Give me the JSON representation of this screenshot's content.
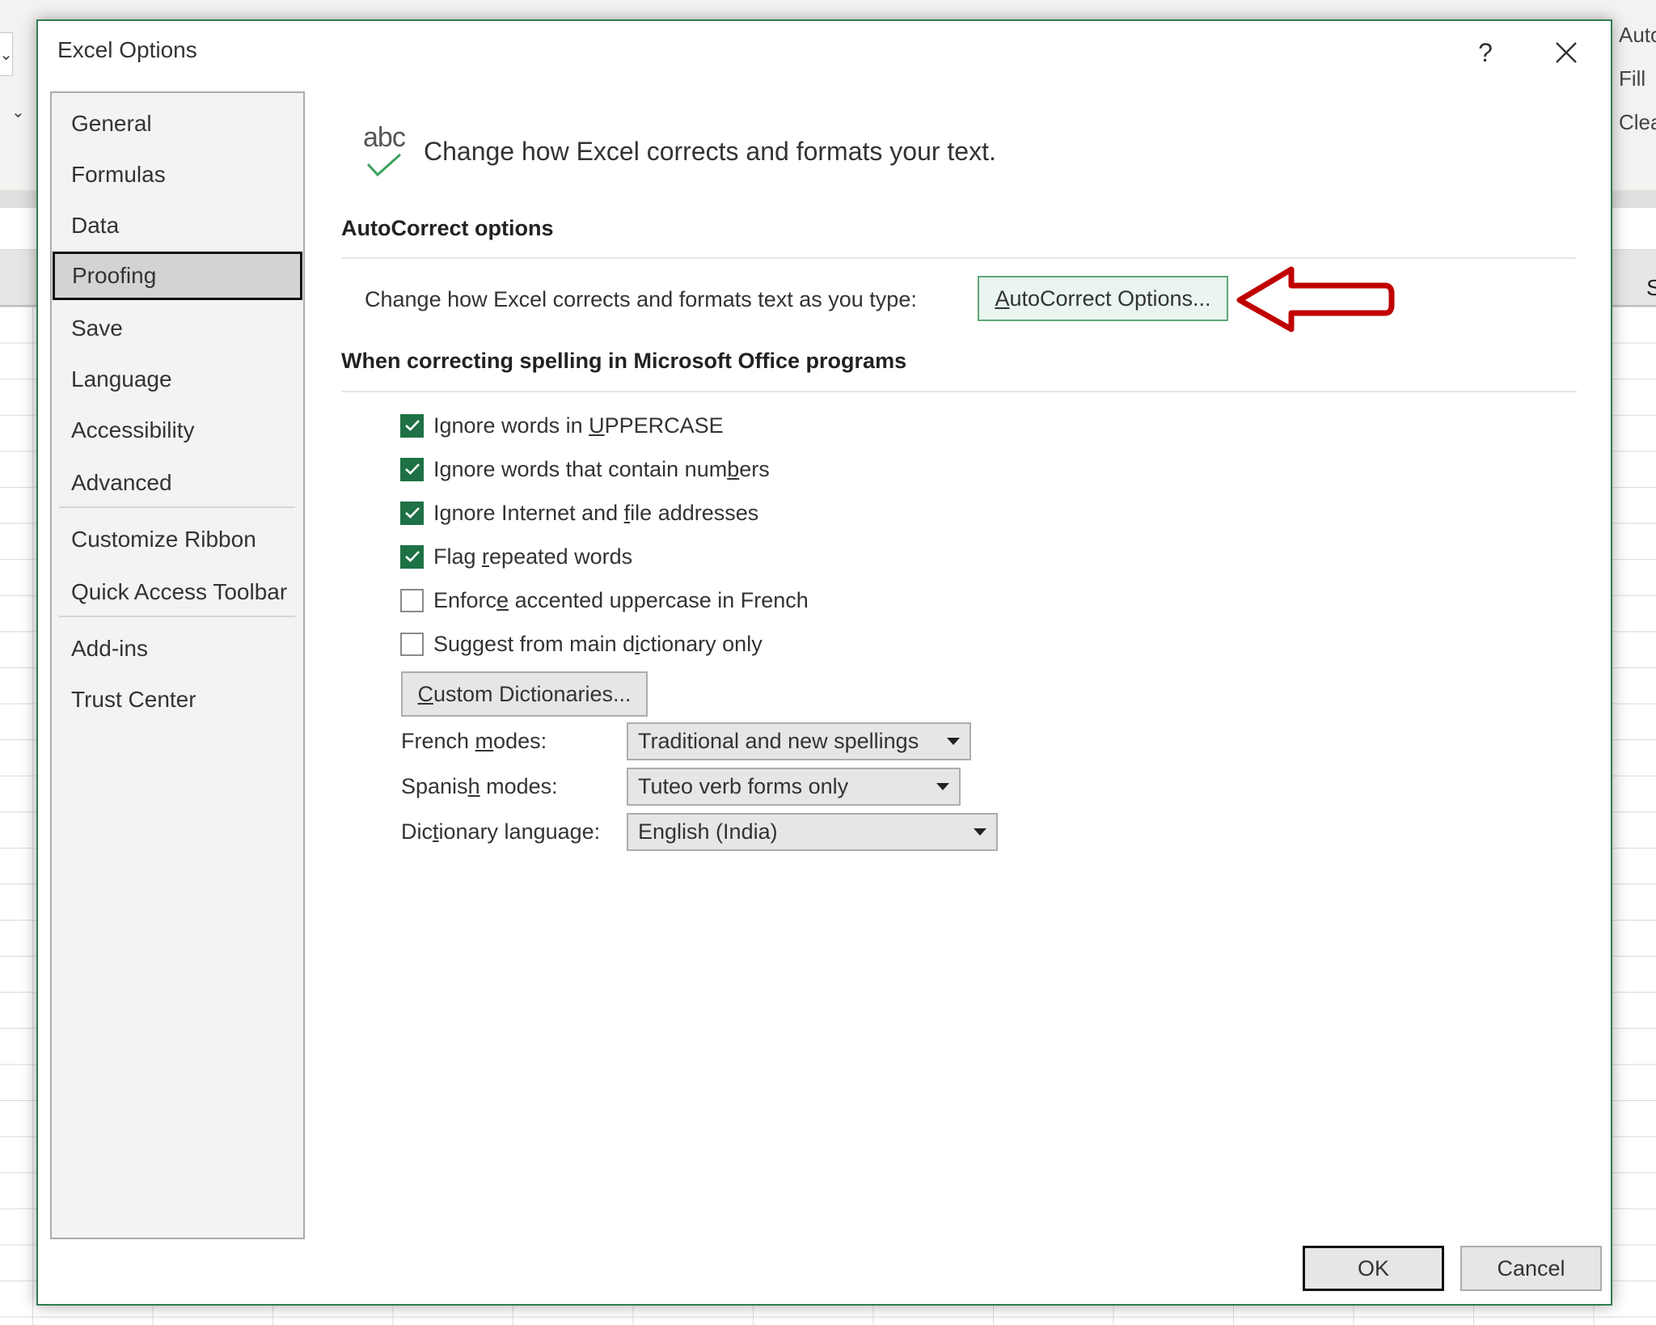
{
  "background": {
    "right_ribbon_items": [
      "Auto",
      "Fill",
      "Clea"
    ],
    "column_letter": "S"
  },
  "dialog": {
    "title": "Excel Options",
    "help_label": "?",
    "close_icon": "close-icon"
  },
  "sidebar": {
    "selected": "Proofing",
    "groups": [
      [
        "General",
        "Formulas",
        "Data",
        "Proofing",
        "Save",
        "Language",
        "Accessibility",
        "Advanced"
      ],
      [
        "Customize Ribbon",
        "Quick Access Toolbar"
      ],
      [
        "Add-ins",
        "Trust Center"
      ]
    ]
  },
  "header": {
    "icon": "abc-check-icon",
    "icon_text": "abc",
    "text": "Change how Excel corrects and formats your text."
  },
  "autocorrect": {
    "title": "AutoCorrect options",
    "description": "Change how Excel corrects and formats text as you type:",
    "button": {
      "accel": "A",
      "rest": "utoCorrect Options..."
    },
    "annotation": "red-arrow-pointing-left"
  },
  "spelling": {
    "title": "When correcting spelling in Microsoft Office programs",
    "options": [
      {
        "pre": "Ignore words in ",
        "accel": "U",
        "post": "PPERCASE",
        "checked": true
      },
      {
        "pre": "Ignore words that contain num",
        "accel": "b",
        "post": "ers",
        "checked": true
      },
      {
        "pre": "Ignore Internet and ",
        "accel": "f",
        "post": "ile addresses",
        "checked": true
      },
      {
        "pre": "Flag ",
        "accel": "r",
        "post": "epeated words",
        "checked": true
      },
      {
        "pre": "Enforc",
        "accel": "e",
        "post": " accented uppercase in French",
        "checked": false
      },
      {
        "pre": "Suggest from main d",
        "accel": "i",
        "post": "ctionary only",
        "checked": false
      }
    ],
    "custom_dictionaries": {
      "accel": "C",
      "rest": "ustom Dictionaries..."
    },
    "french_modes": {
      "pre": "French ",
      "accel": "m",
      "post": "odes:",
      "value": "Traditional and new spellings"
    },
    "spanish_modes": {
      "pre": "Spanis",
      "accel": "h",
      "post": " modes:",
      "value": "Tuteo verb forms only"
    },
    "dictionary_language": {
      "pre": "Dic",
      "accel": "t",
      "post": "ionary language:",
      "value": "English (India)"
    }
  },
  "footer": {
    "ok": "OK",
    "cancel": "Cancel"
  },
  "colors": {
    "accent_green": "#1e7145",
    "dialog_border": "#2e7d4f",
    "annotation_red": "#c00000"
  }
}
